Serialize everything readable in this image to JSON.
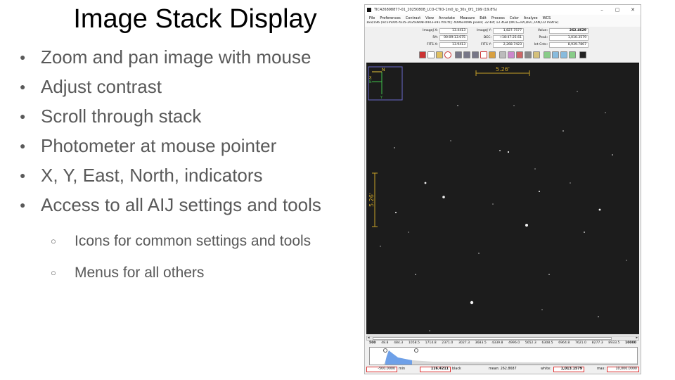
{
  "slide": {
    "title": "Image Stack Display",
    "bullets": [
      "Zoom and pan image with mouse",
      "Adjust contrast",
      "Scroll through stack",
      "Photometer at mouse pointer",
      "X, Y, East, North, indicators",
      "Access to all AIJ settings and tools"
    ],
    "sub_bullets": [
      "Icons for common settings and tools",
      "Menus for all others"
    ]
  },
  "aij_window": {
    "title": "TIC426898877-01_20250808_LCO-CTIO-1m0_ip_30s_0f1_199 (19.8%)",
    "window_buttons": [
      "–",
      "▢",
      "✕"
    ],
    "menus": [
      "File",
      "Preferences",
      "Contrast",
      "View",
      "Annotate",
      "Measure",
      "Edit",
      "Process",
      "Color",
      "Analyze",
      "WCS"
    ],
    "info_line": "183/196 (lsc1m005-fa15-20250808-0443-e91.fits.fz); 4096x4096 pixels; 32-bit; 12.4GB (WCS=RA,DEC,TAN,CD matrix)",
    "coords": {
      "imagej_x_label": "ImageJ X:",
      "imagej_x": "13.4413",
      "imagej_y_label": "ImageJ Y:",
      "imagej_y": "1,827.7577",
      "value_label": "Value:",
      "value": "262.4629",
      "ra_label": "RA:",
      "ra": "00:09:13.075",
      "dec_label": "DEC:",
      "dec": "+18:47:25.61",
      "peak_label": "Peak:",
      "peak": "1,010.3579",
      "fits_x_label": "FITS X:",
      "fits_x": "13.9413",
      "fits_y_label": "FITS Y:",
      "fits_y": "2,268.7423",
      "intcnts_label": "Int Cnts:",
      "intcnts": "8,939.7867"
    },
    "scale_bar_label": "5.26'",
    "scale_bar_vertical_label": "5.26'",
    "compass": {
      "north": "N",
      "east": "E",
      "x": "X",
      "y": "Y"
    },
    "histogram_ticks": [
      "500",
      "48.8",
      "484.3",
      "1058.5",
      "1714.8",
      "2371.0",
      "3027.3",
      "3683.5",
      "4339.8",
      "4996.0",
      "5652.3",
      "6308.5",
      "6964.8",
      "7621.0",
      "8277.3",
      "8933.5",
      "10000"
    ],
    "histogram_level": 0.22,
    "bottom": {
      "min_value": "-500.0000",
      "min_label": "min",
      "black_value": "116.4211",
      "black_label": "black",
      "mean_text": "mean: 262.8687",
      "white_label": "white:",
      "white_value": "1,013.1579",
      "max_label": "max:",
      "max_value": "10,000.0000"
    },
    "colors": {
      "image_background": "#1c1c1c",
      "overlay": "#c9a227",
      "compass_north": "#e8c93a",
      "compass_east": "#3fc24a",
      "compass_box": "#6a6acb",
      "histogram_fill": "#6ea0e8",
      "bottom_box_border": "#dd3333"
    }
  }
}
